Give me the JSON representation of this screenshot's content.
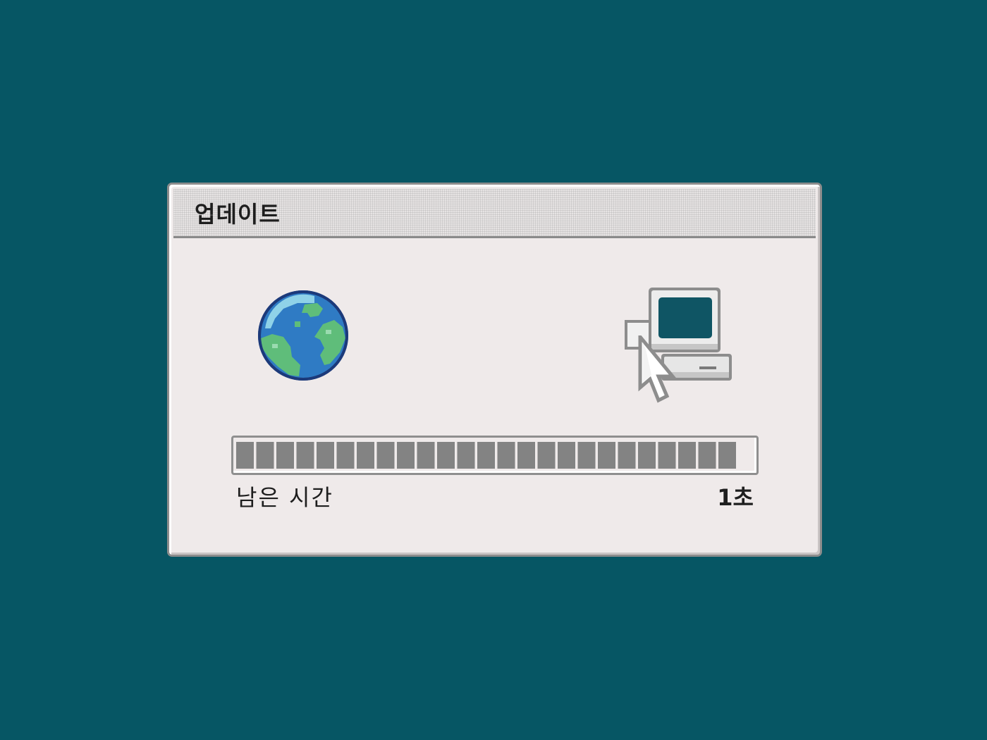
{
  "window": {
    "title": "업데이트"
  },
  "progress": {
    "fraction": 0.97
  },
  "status": {
    "remaining_label": "남은 시간",
    "remaining_value": "1초"
  },
  "icons": {
    "source": "globe-icon",
    "destination": "computer-icon",
    "cursor": "arrow-cursor-icon"
  },
  "colors": {
    "desktop": "#065664",
    "dialog": "#efeaea",
    "progress": "#838383",
    "globe_ocean": "#2f7bc4",
    "globe_land": "#5fbd7a",
    "screen": "#0f5564"
  }
}
